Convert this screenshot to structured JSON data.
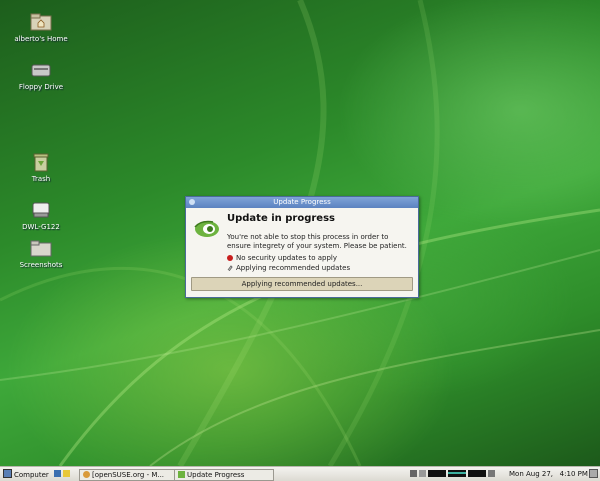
{
  "desktop": {
    "icons": [
      {
        "label": "alberto's Home",
        "icon": "home-folder-icon"
      },
      {
        "label": "Floppy Drive",
        "icon": "floppy-drive-icon"
      },
      {
        "label": "Trash",
        "icon": "trash-icon"
      },
      {
        "label": "DWL-G122",
        "icon": "usb-drive-icon"
      },
      {
        "label": "Screenshots",
        "icon": "folder-icon"
      }
    ]
  },
  "dialog": {
    "title": "Update Progress",
    "heading": "Update in progress",
    "message": "You're not able to stop this process in order to ensure integrety of your system. Please be patient.",
    "status": [
      {
        "text": "No security updates to apply",
        "icon": "red-dot-icon"
      },
      {
        "text": "Applying recommended updates",
        "icon": "paperclip-icon"
      }
    ],
    "progress_text": "Applying recommended updates...",
    "progress_fraction": 0
  },
  "taskbar": {
    "menu_label": "Computer",
    "windows": [
      {
        "label": "[openSUSE.org - M...",
        "icon": "browser-icon"
      },
      {
        "label": "Update Progress",
        "icon": "update-icon"
      }
    ],
    "clock": "Mon Aug 27,   4:10 PM"
  }
}
